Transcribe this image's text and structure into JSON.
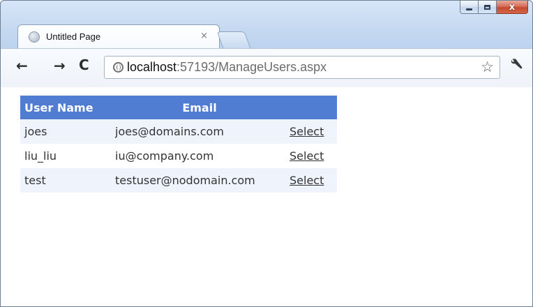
{
  "tab": {
    "title": "Untitled Page",
    "close_glyph": "×"
  },
  "toolbar": {
    "back_glyph": "←",
    "forward_glyph": "→",
    "reload_glyph": "C",
    "url_host": "localhost",
    "url_rest": ":57193/ManageUsers.aspx",
    "star_glyph": "☆"
  },
  "window": {
    "close_glyph": "x"
  },
  "grid": {
    "columns": [
      "User Name",
      "Email",
      ""
    ],
    "rows": [
      {
        "user": "joes",
        "email": "joes@domains.com",
        "action": "Select"
      },
      {
        "user": "liu_liu",
        "email": "iu@company.com",
        "action": "Select"
      },
      {
        "user": "test",
        "email": "testuser@nodomain.com",
        "action": "Select"
      }
    ]
  },
  "colors": {
    "header_bg": "#507cd1",
    "alt_row_bg": "#eff3fb",
    "text": "#333333"
  },
  "icons": {
    "tab_favicon": "globe-icon",
    "omnibox_icon": "globe-icon",
    "bookmark": "star-icon",
    "menu": "wrench-icon"
  }
}
